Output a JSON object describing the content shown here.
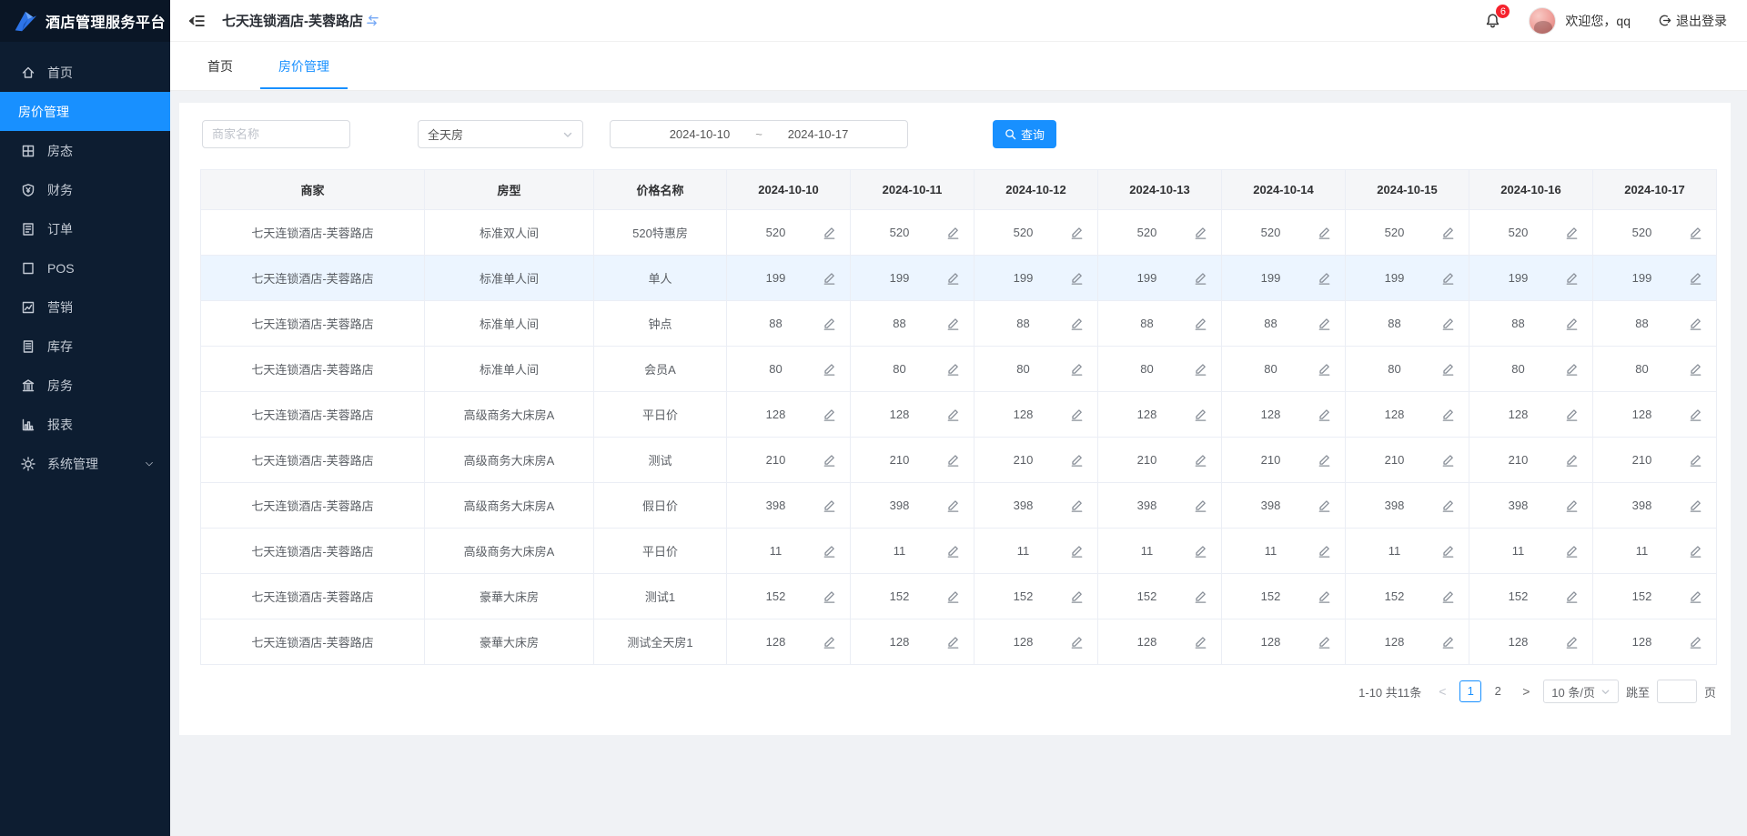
{
  "brand": {
    "title": "酒店管理服务平台",
    "logo_icon": "bird-logo-icon"
  },
  "sidebar": {
    "items": [
      {
        "key": "home",
        "label": "首页",
        "icon": "home-icon",
        "active": false
      },
      {
        "key": "room-price",
        "label": "房价管理",
        "icon": "",
        "active": true
      },
      {
        "key": "room-status",
        "label": "房态",
        "icon": "room-status-icon",
        "active": false
      },
      {
        "key": "finance",
        "label": "财务",
        "icon": "finance-icon",
        "active": false
      },
      {
        "key": "order",
        "label": "订单",
        "icon": "order-icon",
        "active": false
      },
      {
        "key": "pos",
        "label": "POS",
        "icon": "pos-icon",
        "active": false
      },
      {
        "key": "marketing",
        "label": "营销",
        "icon": "marketing-icon",
        "active": false
      },
      {
        "key": "inventory",
        "label": "库存",
        "icon": "inventory-icon",
        "active": false
      },
      {
        "key": "housekeeping",
        "label": "房务",
        "icon": "housekeeping-icon",
        "active": false
      },
      {
        "key": "report",
        "label": "报表",
        "icon": "report-icon",
        "active": false
      },
      {
        "key": "system",
        "label": "系统管理",
        "icon": "settings-icon",
        "active": false,
        "expandable": true
      }
    ]
  },
  "topbar": {
    "store_name": "七天连锁酒店-芙蓉路店",
    "store_switch_icon": "swap-icon",
    "notification_count": "6",
    "welcome_text": "欢迎您，qq",
    "logout_label": "退出登录"
  },
  "tabs": [
    {
      "label": "首页",
      "active": false
    },
    {
      "label": "房价管理",
      "active": true
    }
  ],
  "filters": {
    "merchant_placeholder": "商家名称",
    "room_mode_value": "全天房",
    "date_start": "2024-10-10",
    "date_separator": "~",
    "date_end": "2024-10-17",
    "search_button": "查询"
  },
  "table": {
    "fixed_headers": [
      "商家",
      "房型",
      "价格名称"
    ],
    "date_headers": [
      "2024-10-10",
      "2024-10-11",
      "2024-10-12",
      "2024-10-13",
      "2024-10-14",
      "2024-10-15",
      "2024-10-16",
      "2024-10-17"
    ],
    "rows": [
      {
        "merchant": "七天连锁酒店-芙蓉路店",
        "room_type": "标准双人间",
        "price_name": "520特惠房",
        "prices": [
          "520",
          "520",
          "520",
          "520",
          "520",
          "520",
          "520",
          "520"
        ],
        "highlighted": false
      },
      {
        "merchant": "七天连锁酒店-芙蓉路店",
        "room_type": "标准单人间",
        "price_name": "单人",
        "prices": [
          "199",
          "199",
          "199",
          "199",
          "199",
          "199",
          "199",
          "199"
        ],
        "highlighted": true
      },
      {
        "merchant": "七天连锁酒店-芙蓉路店",
        "room_type": "标准单人间",
        "price_name": "钟点",
        "prices": [
          "88",
          "88",
          "88",
          "88",
          "88",
          "88",
          "88",
          "88"
        ],
        "highlighted": false
      },
      {
        "merchant": "七天连锁酒店-芙蓉路店",
        "room_type": "标准单人间",
        "price_name": "会员A",
        "prices": [
          "80",
          "80",
          "80",
          "80",
          "80",
          "80",
          "80",
          "80"
        ],
        "highlighted": false
      },
      {
        "merchant": "七天连锁酒店-芙蓉路店",
        "room_type": "高级商务大床房A",
        "price_name": "平日价",
        "prices": [
          "128",
          "128",
          "128",
          "128",
          "128",
          "128",
          "128",
          "128"
        ],
        "highlighted": false
      },
      {
        "merchant": "七天连锁酒店-芙蓉路店",
        "room_type": "高级商务大床房A",
        "price_name": "测试",
        "prices": [
          "210",
          "210",
          "210",
          "210",
          "210",
          "210",
          "210",
          "210"
        ],
        "highlighted": false
      },
      {
        "merchant": "七天连锁酒店-芙蓉路店",
        "room_type": "高级商务大床房A",
        "price_name": "假日价",
        "prices": [
          "398",
          "398",
          "398",
          "398",
          "398",
          "398",
          "398",
          "398"
        ],
        "highlighted": false
      },
      {
        "merchant": "七天连锁酒店-芙蓉路店",
        "room_type": "高级商务大床房A",
        "price_name": "平日价",
        "prices": [
          "11",
          "11",
          "11",
          "11",
          "11",
          "11",
          "11",
          "11"
        ],
        "highlighted": false
      },
      {
        "merchant": "七天连锁酒店-芙蓉路店",
        "room_type": "豪華大床房",
        "price_name": "测试1",
        "prices": [
          "152",
          "152",
          "152",
          "152",
          "152",
          "152",
          "152",
          "152"
        ],
        "highlighted": false
      },
      {
        "merchant": "七天连锁酒店-芙蓉路店",
        "room_type": "豪華大床房",
        "price_name": "测试全天房1",
        "prices": [
          "128",
          "128",
          "128",
          "128",
          "128",
          "128",
          "128",
          "128"
        ],
        "highlighted": false
      }
    ]
  },
  "pagination": {
    "total_text": "1-10 共11条",
    "prev_label": "<",
    "next_label": ">",
    "pages": [
      "1",
      "2"
    ],
    "active_page": "1",
    "page_size_value": "10 条/页",
    "jump_label": "跳至",
    "page_unit": "页"
  },
  "colors": {
    "accent": "#1890ff",
    "sidebar_bg": "#0d1d31",
    "logo_bg": "#0a1626",
    "highlight_row": "#ecf5ff",
    "badge_red": "#f5222d",
    "page_bg": "#f0f2f5"
  }
}
